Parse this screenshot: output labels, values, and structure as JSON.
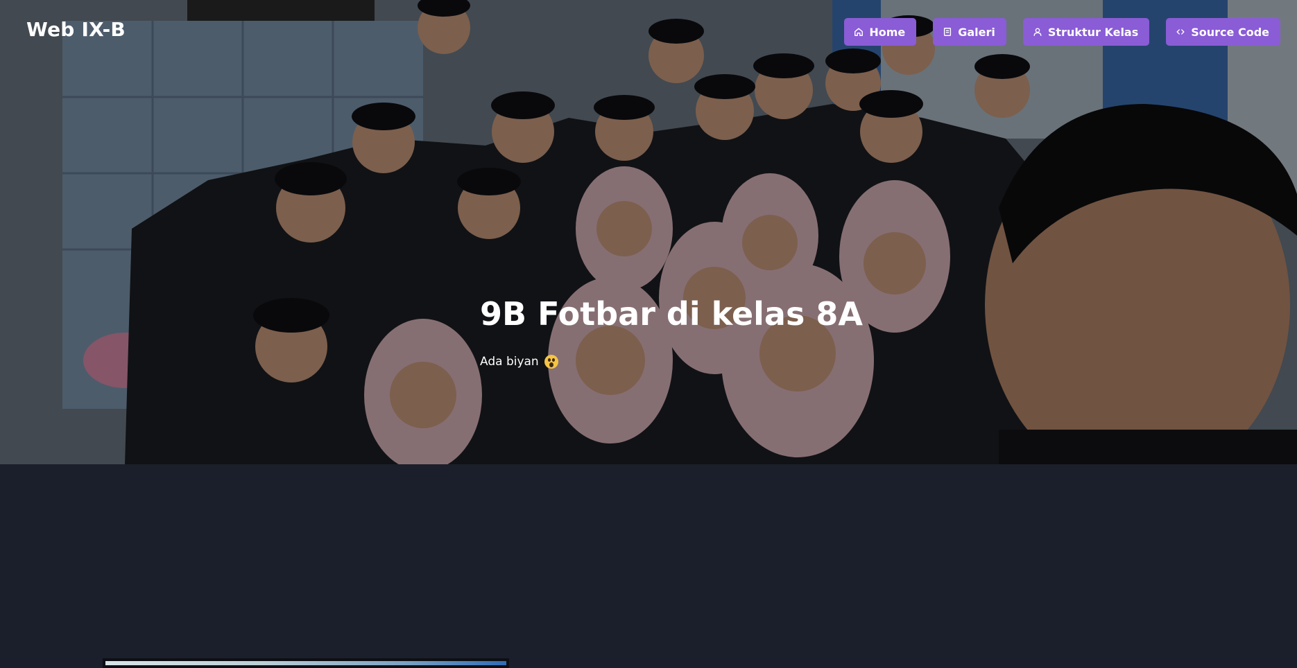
{
  "header": {
    "brand": "Web IX-B",
    "nav": [
      {
        "label": "Home",
        "icon": "home-icon"
      },
      {
        "label": "Galeri",
        "icon": "gallery-icon"
      },
      {
        "label": "Struktur Kelas",
        "icon": "user-icon"
      },
      {
        "label": "Source Code",
        "icon": "code-icon"
      }
    ]
  },
  "hero": {
    "title": "9B Fotbar di kelas 8A",
    "subtitle": "Ada biyan",
    "subtitle_emoji": "scream-emoji"
  },
  "colors": {
    "accent": "#8a5cd6",
    "page_background": "#1b1f2b"
  }
}
